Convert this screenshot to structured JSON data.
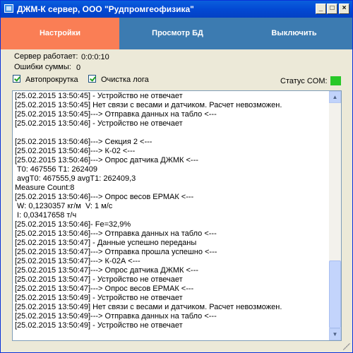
{
  "window": {
    "title": "ДЖМ-К сервер, ООО \"Рудпромгеофизика\"",
    "buttons": {
      "minimize": "_",
      "maximize": "□",
      "close": "×"
    }
  },
  "nav": {
    "settings_label": "Настройки",
    "settings_color": "#fa7e55",
    "view_db_label": "Просмотр БД",
    "view_db_color": "#3c7bb1",
    "shutdown_label": "Выключить",
    "shutdown_color": "#3c7bb1"
  },
  "status": {
    "server_running_label": "Сервер работает:",
    "server_running_value": "0:0:0:10",
    "sum_errors_label": "Ошибки суммы:",
    "sum_errors_value": "0",
    "autoscroll_label": "Автопрокрутка",
    "autoscroll_checked": true,
    "clear_log_label": "Очистка лога",
    "clear_log_checked": true,
    "com_status_label": "Статус COM:",
    "com_status_color": "#28c828"
  },
  "log": {
    "lines": [
      "[25.02.2015 13:50:45] - Устройство не отвечает",
      "[25.02.2015 13:50:45] Нет связи с весами и датчиком. Расчет невозможен.",
      "[25.02.2015 13:50:45]---> Отправка данных на табло <---",
      "[25.02.2015 13:50:46] - Устройство не отвечает",
      "",
      "[25.02.2015 13:50:46]---> Секция 2 <---",
      "[25.02.2015 13:50:46]---> К-02 <---",
      "[25.02.2015 13:50:46]---> Опрос датчика ДЖМК <---",
      " T0: 467556 T1: 262409",
      " avgT0: 467555,9 avgT1: 262409,3",
      "Measure Count:8",
      "[25.02.2015 13:50:46]---> Опрос весов ЕРМАК <---",
      " W: 0,1230357 кг/м  V: 1 м/с",
      " I: 0,03417658 т/ч",
      "[25.02.2015 13:50:46]- Fe=32,9%",
      "[25.02.2015 13:50:46]---> Отправка данных на табло <---",
      "[25.02.2015 13:50:47] - Данные успешно переданы",
      "[25.02.2015 13:50:47]---> Отправка прошла успешно <---",
      "[25.02.2015 13:50:47]---> К-02А <---",
      "[25.02.2015 13:50:47]---> Опрос датчика ДЖМК <---",
      "[25.02.2015 13:50:47] - Устройство не отвечает",
      "[25.02.2015 13:50:47]---> Опрос весов ЕРМАК <---",
      "[25.02.2015 13:50:49] - Устройство не отвечает",
      "[25.02.2015 13:50:49] Нет связи с весами и датчиком. Расчет невозможен.",
      "[25.02.2015 13:50:49]---> Отправка данных на табло <---",
      "[25.02.2015 13:50:49] - Устройство не отвечает"
    ],
    "scroll_up_glyph": "▲",
    "scroll_down_glyph": "▼"
  }
}
